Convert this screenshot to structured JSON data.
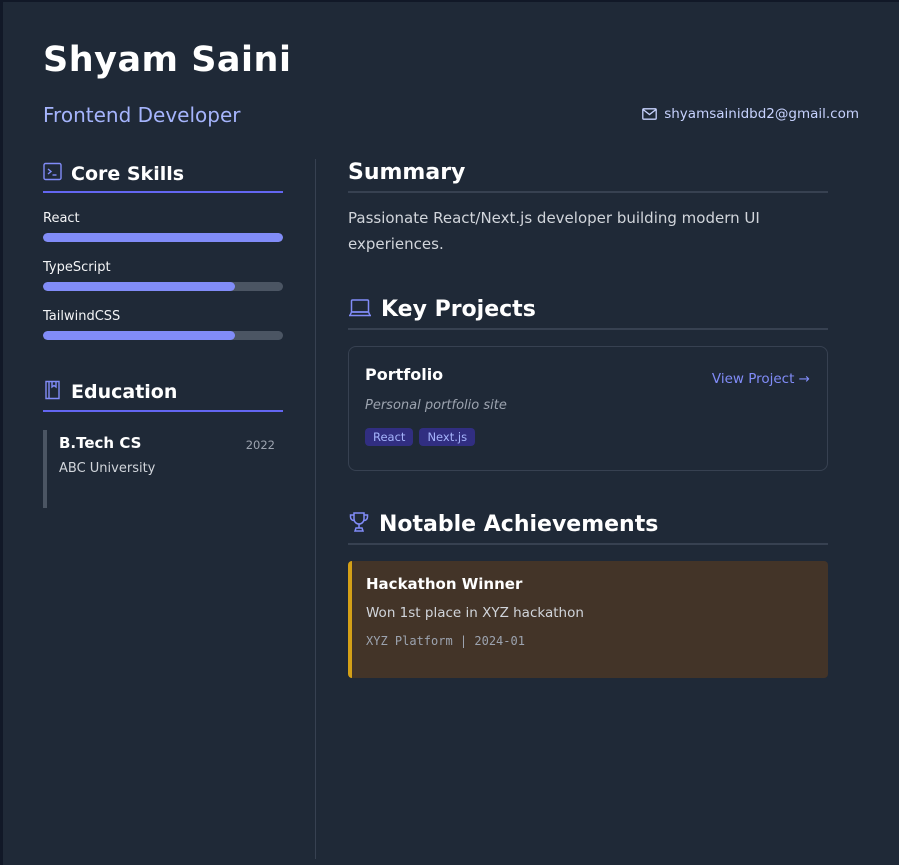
{
  "header": {
    "name": "Shyam Saini",
    "role": "Frontend Developer",
    "email": "shyamsainidbd2@gmail.com",
    "email_icon": "mail-icon"
  },
  "skills": {
    "title": "Core Skills",
    "icon": "terminal-icon",
    "items": [
      {
        "label": "React",
        "level": 1.0
      },
      {
        "label": "TypeScript",
        "level": 0.8
      },
      {
        "label": "TailwindCSS",
        "level": 0.8
      }
    ]
  },
  "education": {
    "title": "Education",
    "icon": "book-icon",
    "items": [
      {
        "degree": "B.Tech CS",
        "school": "ABC University",
        "year": "2022"
      }
    ]
  },
  "summary": {
    "title": "Summary",
    "text": "Passionate React/Next.js developer building modern UI experiences."
  },
  "projects": {
    "title": "Key Projects",
    "icon": "laptop-icon",
    "items": [
      {
        "title": "Portfolio",
        "link_label": "View Project →",
        "description": "Personal portfolio site",
        "tags": [
          "React",
          "Next.js"
        ]
      }
    ]
  },
  "achievements": {
    "title": "Notable Achievements",
    "icon": "trophy-icon",
    "items": [
      {
        "title": "Hackathon Winner",
        "description": "Won 1st place in XYZ hackathon",
        "meta": "XYZ Platform | 2024-01"
      }
    ]
  },
  "colors": {
    "background": "#1f2937",
    "accent": "#6366f1",
    "achievement_border": "#d4a017"
  }
}
